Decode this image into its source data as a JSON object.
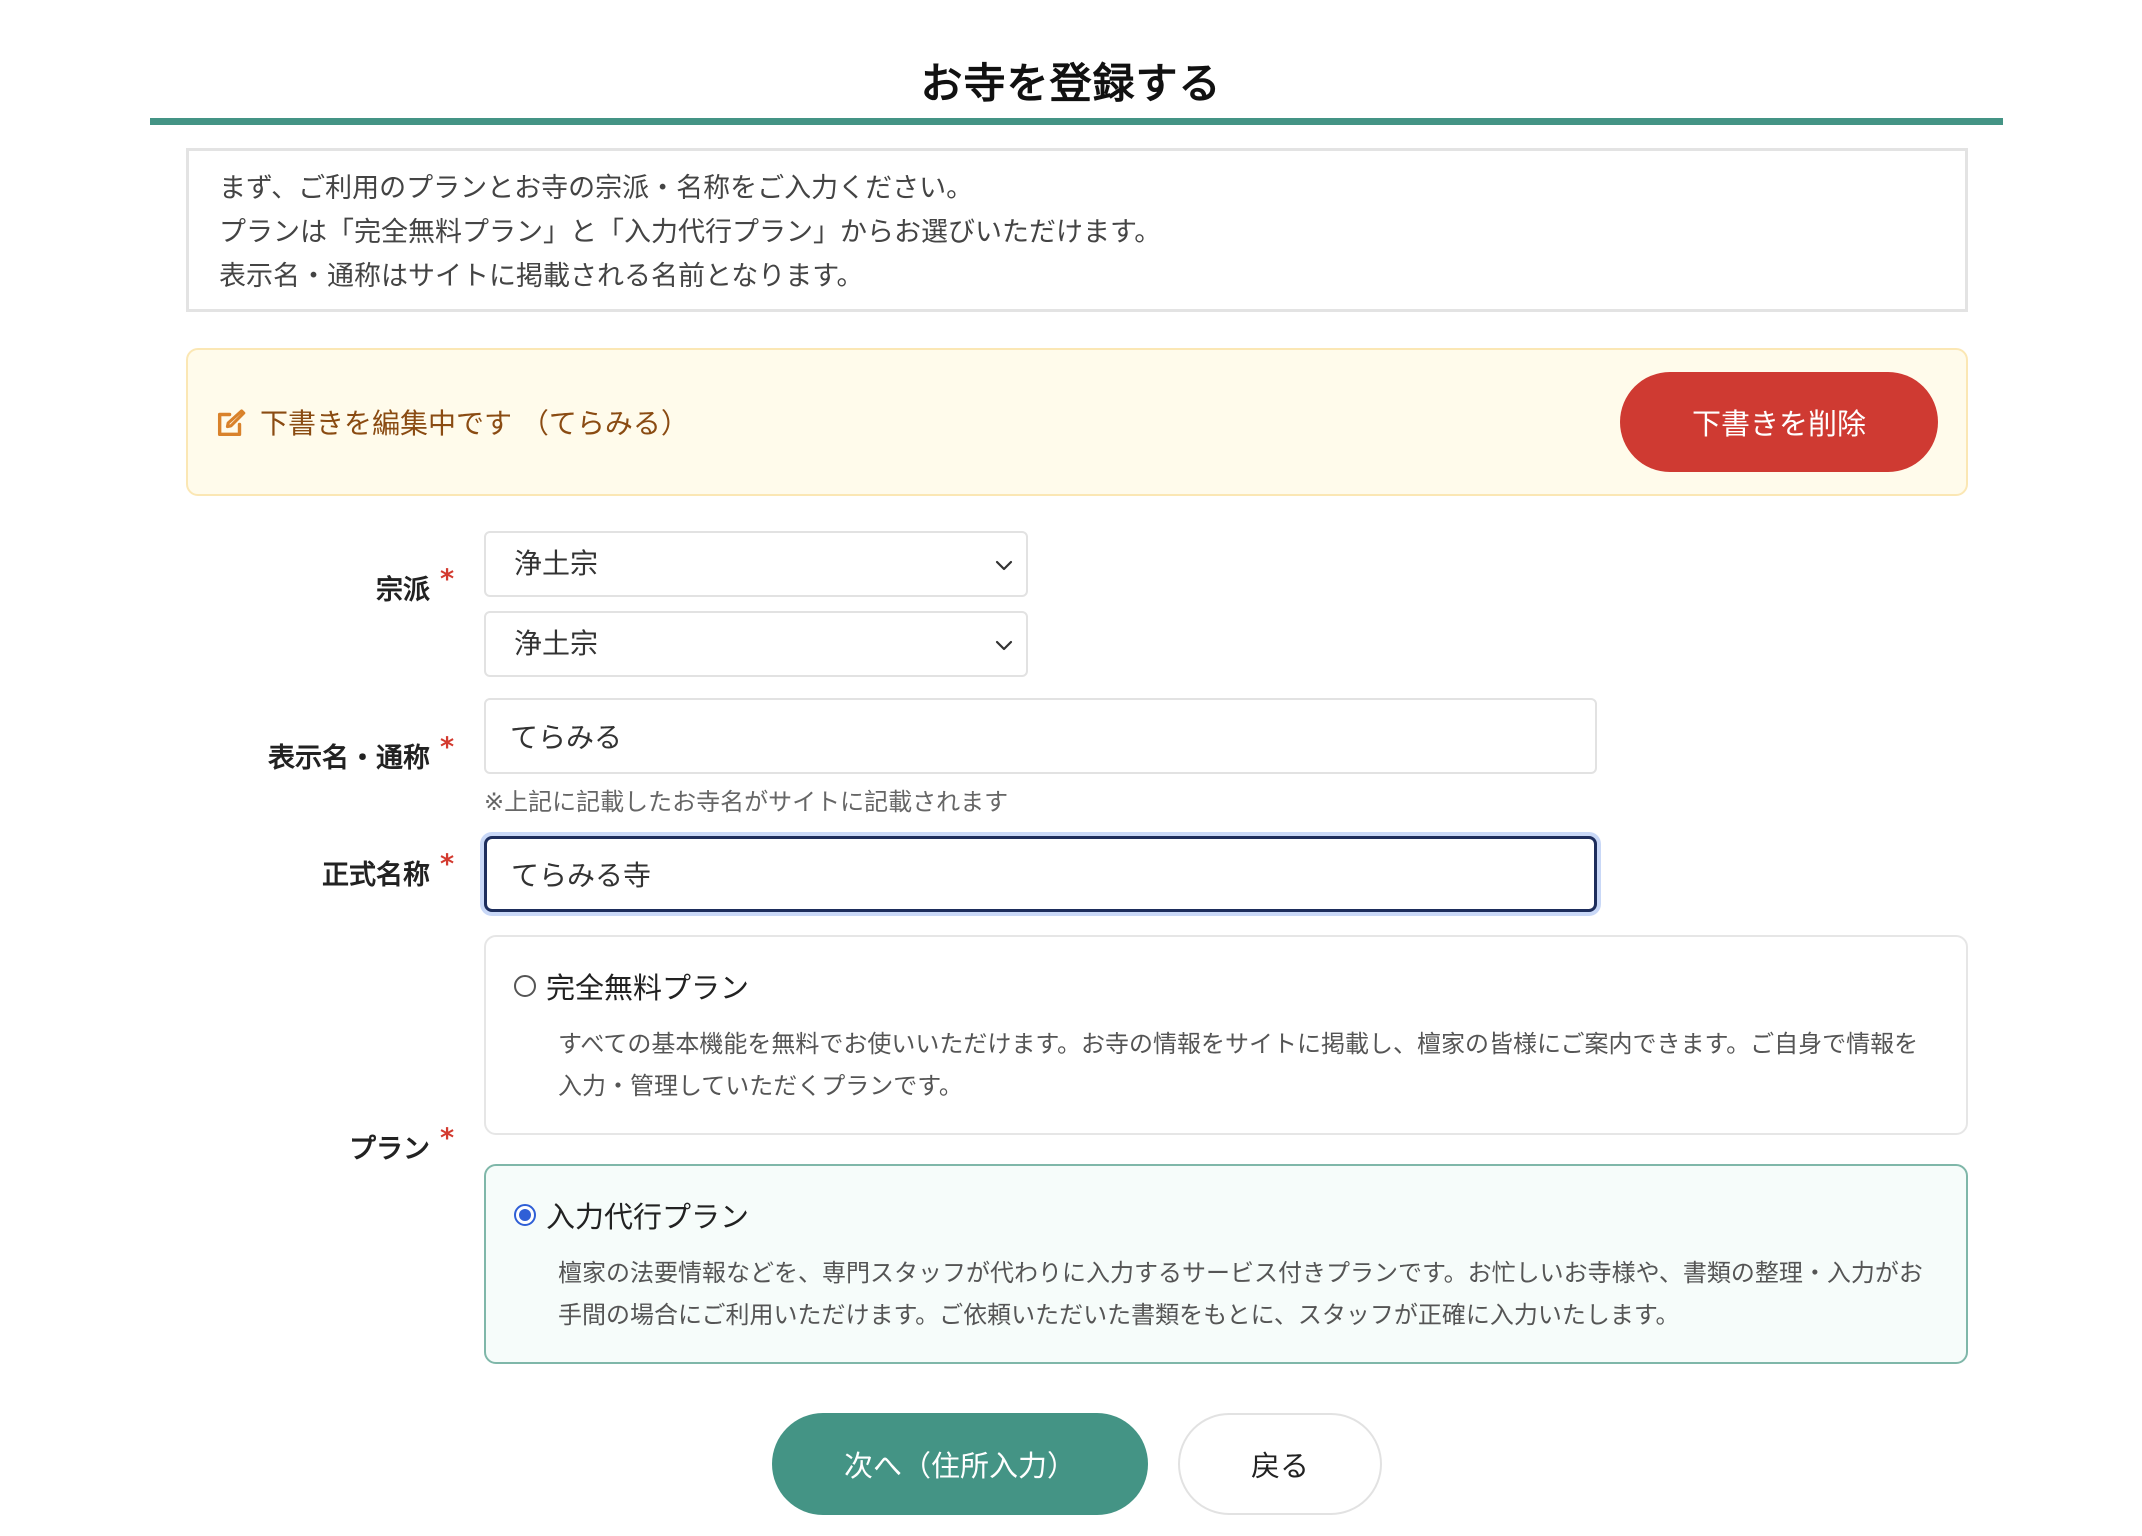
{
  "page": {
    "title": "お寺を登録する"
  },
  "intro": {
    "lines": [
      "まず、ご利用のプランとお寺の宗派・名称をご入力ください。",
      "プランは「完全無料プラン」と「入力代行プラン」からお選びいただけます。",
      "表示名・通称はサイトに掲載される名前となります。"
    ]
  },
  "draft": {
    "status_text": "下書きを編集中です （てらみる）",
    "delete_label": "下書きを削除",
    "icon": "edit-icon"
  },
  "form": {
    "required_mark": "*",
    "sect": {
      "label": "宗派",
      "primary_value": "浄土宗",
      "secondary_value": "浄土宗"
    },
    "display_name": {
      "label": "表示名・通称",
      "value": "てらみる",
      "help": "※上記に記載したお寺名がサイトに記載されます"
    },
    "official_name": {
      "label": "正式名称",
      "value": "てらみる寺"
    },
    "plan": {
      "label": "プラン",
      "options": [
        {
          "name": "完全無料プラン",
          "description": "すべての基本機能を無料でお使いいただけます。お寺の情報をサイトに掲載し、檀家の皆様にご案内できます。ご自身で情報を入力・管理していただくプランです。",
          "selected": false
        },
        {
          "name": "入力代行プラン",
          "description": "檀家の法要情報などを、専門スタッフが代わりに入力するサービス付きプランです。お忙しいお寺様や、書類の整理・入力がお手間の場合にご利用いただけます。ご依頼いただいた書類をもとに、スタッフが正確に入力いたします。",
          "selected": true
        }
      ]
    }
  },
  "actions": {
    "next_label": "次へ（住所入力）",
    "back_label": "戻る"
  },
  "colors": {
    "accent": "#449485",
    "danger": "#cf3a32",
    "draft_background": "#fffbeb",
    "draft_text": "#8a4b12",
    "required": "#d33a2f",
    "radio_selected": "#2f5fd6"
  }
}
